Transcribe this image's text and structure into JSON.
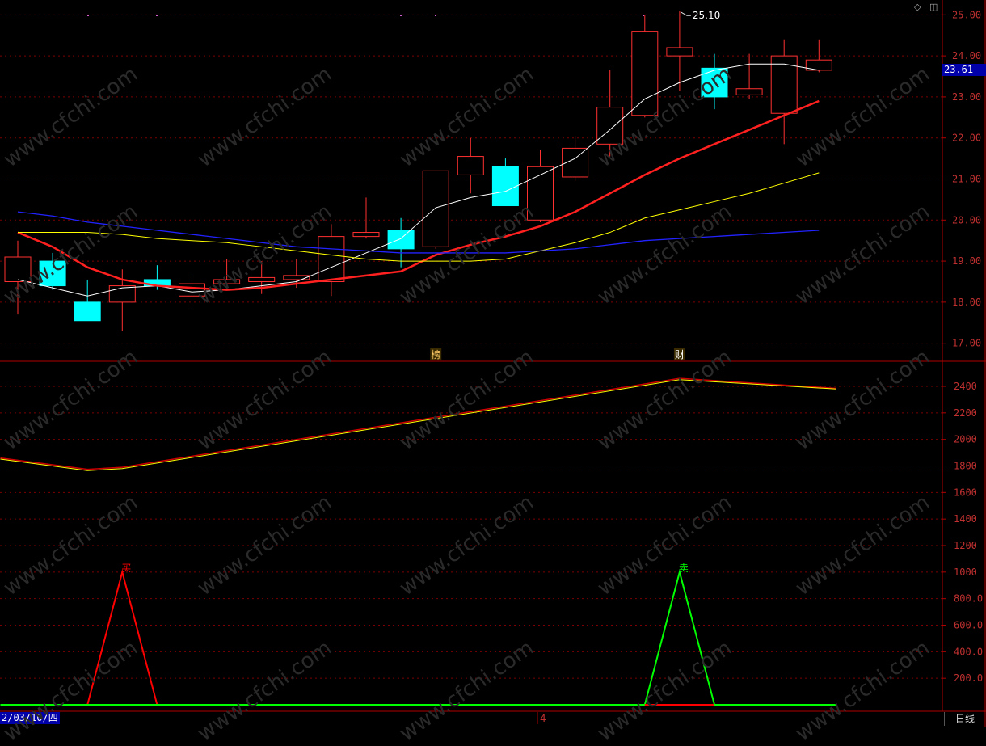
{
  "chart_data": [
    {
      "type": "candlestick",
      "title": "",
      "ylim": [
        16.6,
        25.4
      ],
      "y_ticks": [
        "25.00",
        "24.00",
        "23.00",
        "22.00",
        "21.00",
        "20.00",
        "19.00",
        "18.00",
        "17.00"
      ],
      "last_price": "23.61",
      "high_marker": "25.10",
      "candles": [
        {
          "o": 18.5,
          "c": 19.1,
          "h": 19.5,
          "l": 17.7,
          "dir": "up"
        },
        {
          "o": 19.0,
          "c": 18.4,
          "h": 19.2,
          "l": 18.3,
          "dir": "down"
        },
        {
          "o": 18.0,
          "c": 17.55,
          "h": 18.55,
          "l": 17.55,
          "dir": "down"
        },
        {
          "o": 18.0,
          "c": 18.4,
          "h": 18.8,
          "l": 17.3,
          "dir": "up"
        },
        {
          "o": 18.55,
          "c": 18.4,
          "h": 18.9,
          "l": 18.3,
          "dir": "down"
        },
        {
          "o": 18.15,
          "c": 18.45,
          "h": 18.65,
          "l": 17.9,
          "dir": "up"
        },
        {
          "o": 18.45,
          "c": 18.55,
          "h": 19.05,
          "l": 18.3,
          "dir": "up"
        },
        {
          "o": 18.5,
          "c": 18.6,
          "h": 19.0,
          "l": 18.2,
          "dir": "up"
        },
        {
          "o": 18.55,
          "c": 18.65,
          "h": 19.05,
          "l": 18.35,
          "dir": "up"
        },
        {
          "o": 18.5,
          "c": 19.6,
          "h": 19.9,
          "l": 18.15,
          "dir": "up"
        },
        {
          "o": 19.6,
          "c": 19.7,
          "h": 20.55,
          "l": 19.55,
          "dir": "up"
        },
        {
          "o": 19.75,
          "c": 19.3,
          "h": 20.05,
          "l": 18.85,
          "dir": "down"
        },
        {
          "o": 19.35,
          "c": 21.2,
          "h": 21.2,
          "l": 19.3,
          "dir": "up"
        },
        {
          "o": 21.1,
          "c": 21.55,
          "h": 22.0,
          "l": 20.65,
          "dir": "up"
        },
        {
          "o": 21.3,
          "c": 20.35,
          "h": 21.5,
          "l": 20.35,
          "dir": "down"
        },
        {
          "o": 20.0,
          "c": 21.3,
          "h": 21.7,
          "l": 19.95,
          "dir": "up"
        },
        {
          "o": 21.05,
          "c": 21.75,
          "h": 22.05,
          "l": 20.95,
          "dir": "up"
        },
        {
          "o": 21.85,
          "c": 22.75,
          "h": 23.65,
          "l": 21.55,
          "dir": "up"
        },
        {
          "o": 22.55,
          "c": 24.6,
          "h": 25.0,
          "l": 22.5,
          "dir": "up"
        },
        {
          "o": 24.0,
          "c": 24.2,
          "h": 25.1,
          "l": 23.15,
          "dir": "up"
        },
        {
          "o": 23.7,
          "c": 23.0,
          "h": 24.05,
          "l": 22.7,
          "dir": "down"
        },
        {
          "o": 23.05,
          "c": 23.2,
          "h": 24.05,
          "l": 22.95,
          "dir": "up"
        },
        {
          "o": 22.6,
          "c": 24.0,
          "h": 24.4,
          "l": 21.85,
          "dir": "up"
        },
        {
          "o": 23.65,
          "c": 23.9,
          "h": 24.4,
          "l": 23.6,
          "dir": "up"
        }
      ],
      "ma_series": [
        {
          "color": "#ffffff",
          "width": 1,
          "values": [
            18.55,
            18.35,
            18.15,
            18.35,
            18.4,
            18.25,
            18.3,
            18.4,
            18.5,
            18.85,
            19.2,
            19.55,
            20.3,
            20.55,
            20.7,
            21.1,
            21.5,
            22.2,
            22.95,
            23.35,
            23.65,
            23.8,
            23.8,
            23.65
          ]
        },
        {
          "color": "#ff2020",
          "width": 2.5,
          "values": [
            19.7,
            19.35,
            18.85,
            18.55,
            18.4,
            18.35,
            18.3,
            18.35,
            18.45,
            18.55,
            18.65,
            18.75,
            19.15,
            19.4,
            19.6,
            19.85,
            20.2,
            20.65,
            21.1,
            21.5,
            21.85,
            22.2,
            22.55,
            22.9
          ]
        },
        {
          "color": "#ffff00",
          "width": 1,
          "values": [
            19.7,
            19.7,
            19.7,
            19.65,
            19.55,
            19.5,
            19.45,
            19.35,
            19.25,
            19.15,
            19.05,
            19.0,
            19.0,
            19.0,
            19.05,
            19.25,
            19.45,
            19.7,
            20.05,
            20.25,
            20.45,
            20.65,
            20.9,
            21.15
          ]
        },
        {
          "color": "#2222ff",
          "width": 1.3,
          "values": [
            20.2,
            20.1,
            19.95,
            19.85,
            19.75,
            19.65,
            19.55,
            19.45,
            19.35,
            19.3,
            19.25,
            19.2,
            19.2,
            19.2,
            19.2,
            19.25,
            19.3,
            19.4,
            19.5,
            19.55,
            19.6,
            19.65,
            19.7,
            19.75
          ]
        }
      ],
      "tags": [
        {
          "index": 12,
          "text": "榜",
          "color": "#ffcc66"
        },
        {
          "index": 19,
          "text": "财",
          "color": "#ffffff"
        }
      ]
    },
    {
      "type": "line",
      "title": "",
      "ylim": [
        0,
        2600
      ],
      "y_ticks": [
        "2400",
        "2200",
        "2000",
        "1800",
        "1600",
        "1400",
        "1200",
        "1000",
        "800.0",
        "600.0",
        "400.0",
        "200.0"
      ],
      "y_tick_values": [
        2400,
        2200,
        2000,
        1800,
        1600,
        1400,
        1200,
        1000,
        800,
        600,
        400,
        200
      ],
      "series": [
        {
          "color": "#cc0000",
          "width": 1.5,
          "x": [
            -0.5,
            2,
            3,
            19,
            23.5
          ],
          "values": [
            1860,
            1775,
            1790,
            2460,
            2385
          ]
        },
        {
          "color": "#ffff00",
          "width": 1,
          "x": [
            -0.5,
            2,
            3,
            19,
            23.5
          ],
          "values": [
            1852,
            1765,
            1780,
            2450,
            2380
          ]
        },
        {
          "color": "#ff0000",
          "width": 2,
          "x": [
            2,
            3,
            4
          ],
          "values": [
            0,
            1000,
            0
          ]
        },
        {
          "color": "#00ff00",
          "width": 2,
          "x": [
            18,
            19,
            20
          ],
          "values": [
            0,
            1000,
            0
          ]
        },
        {
          "color": "#00ff00",
          "width": 2,
          "x": [
            -0.5,
            23.5
          ],
          "values": [
            0,
            0
          ]
        }
      ],
      "signal_labels": [
        {
          "index": 3,
          "text": "买",
          "color": "#ff0000"
        },
        {
          "index": 19,
          "text": "卖",
          "color": "#00ff00"
        }
      ]
    }
  ],
  "footer": {
    "date_label": "2/03/10/四",
    "mid_label": "4",
    "period_label": "日线"
  },
  "watermark": "www.cfchi.com"
}
